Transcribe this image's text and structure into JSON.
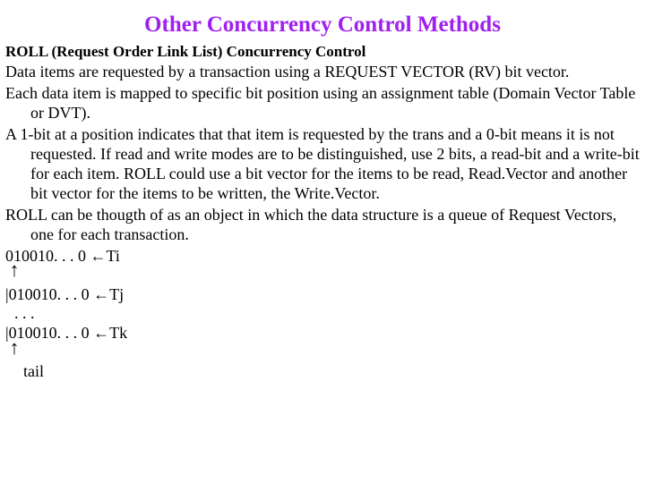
{
  "title": "Other Concurrency Control Methods",
  "subhead": "ROLL (Request Order Link List) Concurrency Control",
  "p1": "Data items are requested by a transaction using a REQUEST VECTOR (RV) bit vector.",
  "p2": "Each data item is mapped to specific bit position using an assignment table (Domain Vector Table or DVT).",
  "p3": "A 1-bit at a position indicates that that item is requested by the trans and a 0-bit means it is not requested. If read and write modes are to be distinguished, use 2 bits, a read-bit and a write-bit for each item.  ROLL could use a bit vector for the items to be read, Read.Vector and another bit vector for the items to be written, the Write.Vector.",
  "p4": "ROLL can be thougth of as an object in which the data structure is a queue of Request Vectors, one for each transaction.",
  "rv": {
    "ti_bits": "010010. . . 0",
    "ti_label": "Ti",
    "tj_bits": "|010010. . . 0",
    "tj_label": "Tj",
    "dots": ". . .",
    "tk_bits": "|010010. . . 0",
    "tk_label": "Tk",
    "tail": "tail"
  },
  "glyphs": {
    "left_arrow": "←",
    "up_arrow": "↑"
  }
}
